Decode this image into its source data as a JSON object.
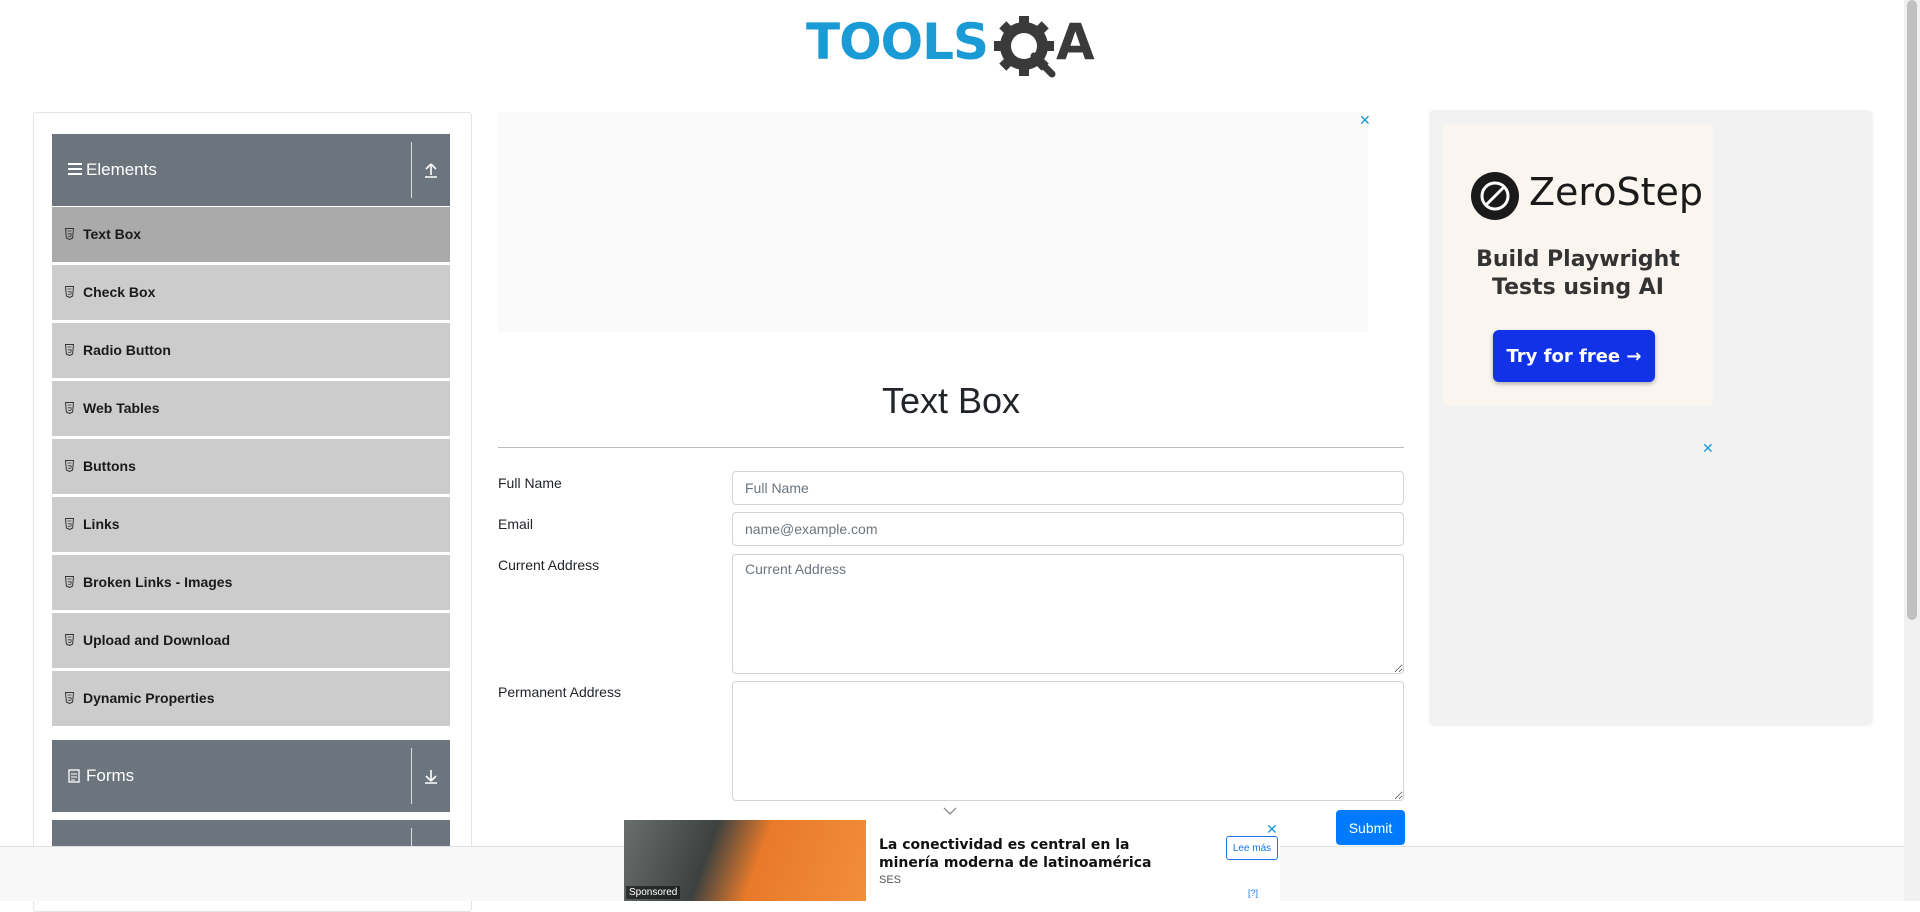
{
  "header": {
    "logo_text_left": "TOOLS",
    "logo_text_right": "A"
  },
  "sidebar": {
    "groups": [
      {
        "title": "Elements",
        "icon": "hamburger-icon",
        "toggle_icon": "collapse-up-icon"
      },
      {
        "title": "Forms",
        "icon": "document-icon",
        "toggle_icon": "expand-down-icon"
      }
    ],
    "items": [
      {
        "label": "Text Box",
        "active": true
      },
      {
        "label": "Check Box"
      },
      {
        "label": "Radio Button"
      },
      {
        "label": "Web Tables"
      },
      {
        "label": "Buttons"
      },
      {
        "label": "Links"
      },
      {
        "label": "Broken Links - Images"
      },
      {
        "label": "Upload and Download"
      },
      {
        "label": "Dynamic Properties"
      }
    ]
  },
  "main": {
    "title": "Text Box",
    "form": {
      "full_name_label": "Full Name",
      "full_name_placeholder": "Full Name",
      "full_name_value": "",
      "email_label": "Email",
      "email_placeholder": "name@example.com",
      "email_value": "",
      "current_address_label": "Current Address",
      "current_address_placeholder": "Current Address",
      "current_address_value": "",
      "permanent_address_label": "Permanent Address",
      "permanent_address_value": "",
      "submit_label": "Submit"
    }
  },
  "ads": {
    "close_symbol": "✕",
    "right_ad": {
      "brand": "ZeroStep",
      "tagline": "Build Playwright Tests using AI",
      "cta": "Try for free →"
    },
    "bottom_ad": {
      "sponsored_tag": "Sponsored",
      "headline": "La conectividad es central en la minería moderna de latinoamérica",
      "source": "SES",
      "cta": "Lee más",
      "info": "[?]"
    }
  },
  "colors": {
    "brand_blue": "#1a9bd6",
    "sidebar_header": "#6c757d",
    "sidebar_item": "#cccccc",
    "sidebar_item_active": "#aaaaaa",
    "submit_button": "#007bff",
    "cta_blue": "#1132e6"
  }
}
